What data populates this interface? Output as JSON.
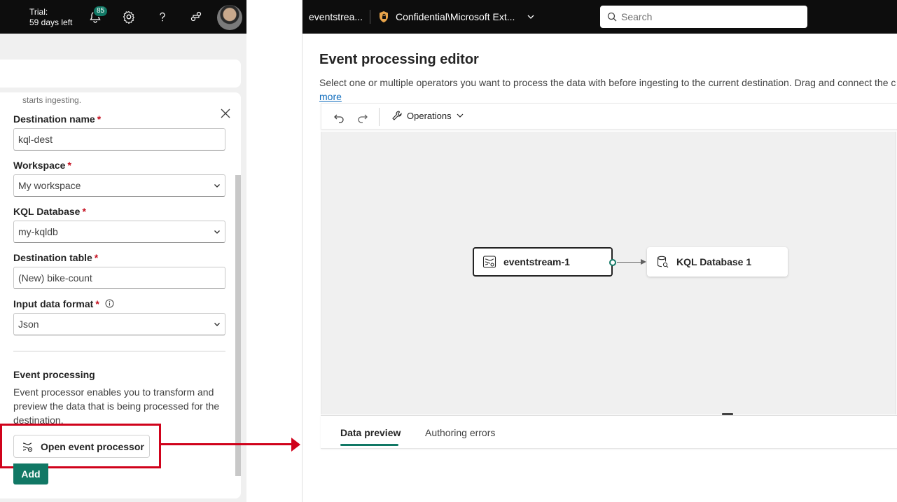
{
  "left_topbar": {
    "trial_line1": "Trial:",
    "trial_line2": "59 days left",
    "notification_count": "85",
    "icons": [
      "bell-icon",
      "gear-icon",
      "help-icon",
      "share-icon",
      "avatar"
    ]
  },
  "form": {
    "truncated_text": "starts ingesting.",
    "destination_name": {
      "label": "Destination name",
      "value": "kql-dest"
    },
    "workspace": {
      "label": "Workspace",
      "value": "My workspace"
    },
    "kql_database": {
      "label": "KQL Database",
      "value": "my-kqldb"
    },
    "destination_table": {
      "label": "Destination table",
      "value": "(New) bike-count"
    },
    "input_data_format": {
      "label": "Input data format",
      "value": "Json"
    },
    "required_marker": "*",
    "event_processing": {
      "title": "Event processing",
      "description": "Event processor enables you to transform and preview the data that is being processed for the destination.",
      "open_button": "Open event processor"
    },
    "add_button": "Add"
  },
  "right_topbar": {
    "item_name": "eventstrea...",
    "sensitivity_label": "Confidential\\Microsoft Ext...",
    "search_placeholder": "Search"
  },
  "editor": {
    "title": "Event processing editor",
    "description": "Select one or multiple operators you want to process the data with before ingesting to the current destination. Drag and connect the c",
    "more_link": "more",
    "toolbar": {
      "operations_label": "Operations"
    },
    "nodes": {
      "source": "eventstream-1",
      "destination": "KQL Database 1"
    },
    "tabs": [
      "Data preview",
      "Authoring errors"
    ]
  },
  "colors": {
    "accent": "#117865",
    "highlight_red": "#d0021b",
    "topbar": "#0d0d0d"
  }
}
